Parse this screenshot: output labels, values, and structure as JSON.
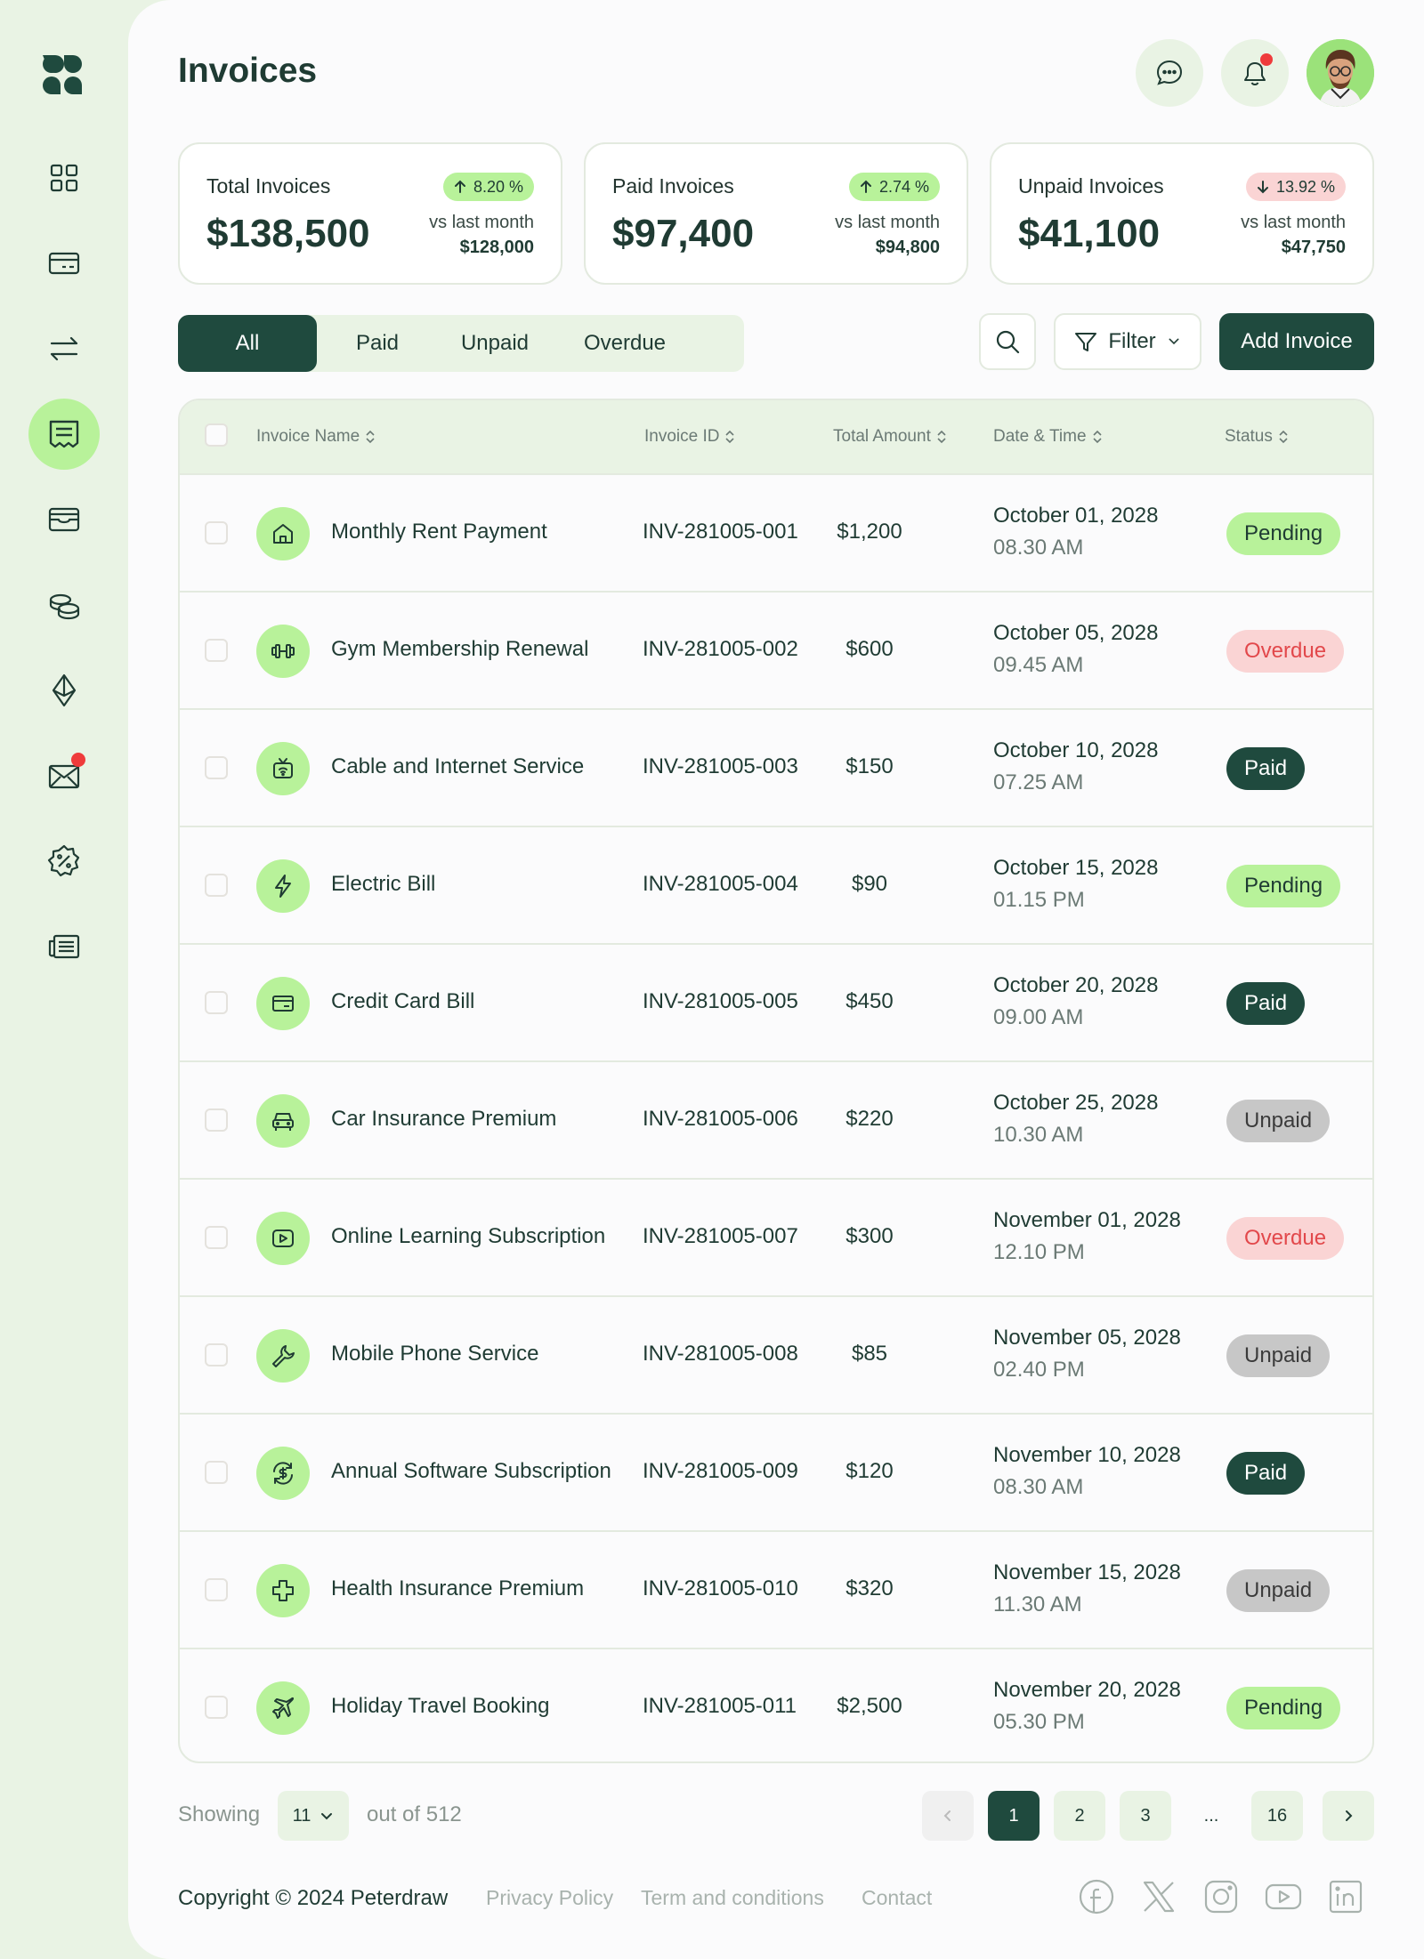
{
  "page": {
    "title": "Invoices"
  },
  "colors": {
    "accent": "#b8f29a",
    "primary": "#1f4a3e",
    "overdue": "#fad4d4",
    "unpaid": "#c7c7c7",
    "notification_dot": "#ef3b3b"
  },
  "sidebar": {
    "items": [
      {
        "icon": "dashboard-grid-icon",
        "active": false
      },
      {
        "icon": "credit-card-icon",
        "active": false
      },
      {
        "icon": "transfer-arrows-icon",
        "active": false
      },
      {
        "icon": "invoice-icon",
        "active": true
      },
      {
        "icon": "wallet-icon",
        "active": false
      },
      {
        "icon": "coins-icon",
        "active": false
      },
      {
        "icon": "ethereum-icon",
        "active": false
      },
      {
        "icon": "mail-icon",
        "active": false,
        "has_notification": true
      },
      {
        "icon": "discount-badge-icon",
        "active": false
      },
      {
        "icon": "news-icon",
        "active": false
      }
    ]
  },
  "header": {
    "chat_icon": "chat-icon",
    "bell_icon": "bell-icon",
    "bell_has_notification": true
  },
  "kpis": [
    {
      "title": "Total Invoices",
      "value": "$138,500",
      "trend": "up",
      "change": "8.20 %",
      "compare_label": "vs last month",
      "compare_value": "$128,000"
    },
    {
      "title": "Paid Invoices",
      "value": "$97,400",
      "trend": "up",
      "change": "2.74 %",
      "compare_label": "vs last month",
      "compare_value": "$94,800"
    },
    {
      "title": "Unpaid Invoices",
      "value": "$41,100",
      "trend": "down",
      "change": "13.92 %",
      "compare_label": "vs last month",
      "compare_value": "$47,750"
    }
  ],
  "tabs": [
    {
      "label": "All",
      "active": true
    },
    {
      "label": "Paid",
      "active": false
    },
    {
      "label": "Unpaid",
      "active": false
    },
    {
      "label": "Overdue",
      "active": false
    }
  ],
  "toolbar": {
    "filter_label": "Filter",
    "add_label": "Add Invoice"
  },
  "table": {
    "columns": [
      "Invoice Name",
      "Invoice ID",
      "Total Amount",
      "Date & Time",
      "Status"
    ],
    "rows": [
      {
        "icon": "home-icon",
        "name": "Monthly Rent Payment",
        "id": "INV-281005-001",
        "amount": "$1,200",
        "date": "October 01, 2028",
        "time": "08.30 AM",
        "status": "Pending"
      },
      {
        "icon": "dumbbell-icon",
        "name": "Gym Membership Renewal",
        "id": "INV-281005-002",
        "amount": "$600",
        "date": "October 05, 2028",
        "time": "09.45 AM",
        "status": "Overdue"
      },
      {
        "icon": "tv-wifi-icon",
        "name": "Cable and Internet Service",
        "id": "INV-281005-003",
        "amount": "$150",
        "date": "October 10, 2028",
        "time": "07.25 AM",
        "status": "Paid"
      },
      {
        "icon": "lightning-icon",
        "name": "Electric Bill",
        "id": "INV-281005-004",
        "amount": "$90",
        "date": "October 15, 2028",
        "time": "01.15 PM",
        "status": "Pending"
      },
      {
        "icon": "credit-card-icon",
        "name": "Credit Card Bill",
        "id": "INV-281005-005",
        "amount": "$450",
        "date": "October 20, 2028",
        "time": "09.00 AM",
        "status": "Paid"
      },
      {
        "icon": "car-icon",
        "name": "Car Insurance Premium",
        "id": "INV-281005-006",
        "amount": "$220",
        "date": "October 25, 2028",
        "time": "10.30 AM",
        "status": "Unpaid"
      },
      {
        "icon": "play-icon",
        "name": "Online Learning Subscription",
        "id": "INV-281005-007",
        "amount": "$300",
        "date": "November 01, 2028",
        "time": "12.10 PM",
        "status": "Overdue"
      },
      {
        "icon": "wrench-icon",
        "name": "Mobile Phone Service",
        "id": "INV-281005-008",
        "amount": "$85",
        "date": "November 05, 2028",
        "time": "02.40 PM",
        "status": "Unpaid"
      },
      {
        "icon": "dollar-cycle-icon",
        "name": "Annual Software Subscription",
        "id": "INV-281005-009",
        "amount": "$120",
        "date": "November 10, 2028",
        "time": "08.30 AM",
        "status": "Paid"
      },
      {
        "icon": "medical-cross-icon",
        "name": "Health Insurance Premium",
        "id": "INV-281005-010",
        "amount": "$320",
        "date": "November 15, 2028",
        "time": "11.30 AM",
        "status": "Unpaid"
      },
      {
        "icon": "airplane-icon",
        "name": "Holiday Travel Booking",
        "id": "INV-281005-011",
        "amount": "$2,500",
        "date": "November 20, 2028",
        "time": "05.30 PM",
        "status": "Pending"
      }
    ]
  },
  "pagination": {
    "showing_label": "Showing",
    "page_size": "11",
    "total_label": "out of 512",
    "pages": [
      "1",
      "2",
      "3",
      "...",
      "16"
    ],
    "current": "1"
  },
  "footer": {
    "copyright": "Copyright © 2024 Peterdraw",
    "links": [
      "Privacy Policy",
      "Term and conditions",
      "Contact"
    ],
    "social": [
      "facebook-icon",
      "x-icon",
      "instagram-icon",
      "youtube-icon",
      "linkedin-icon"
    ]
  }
}
